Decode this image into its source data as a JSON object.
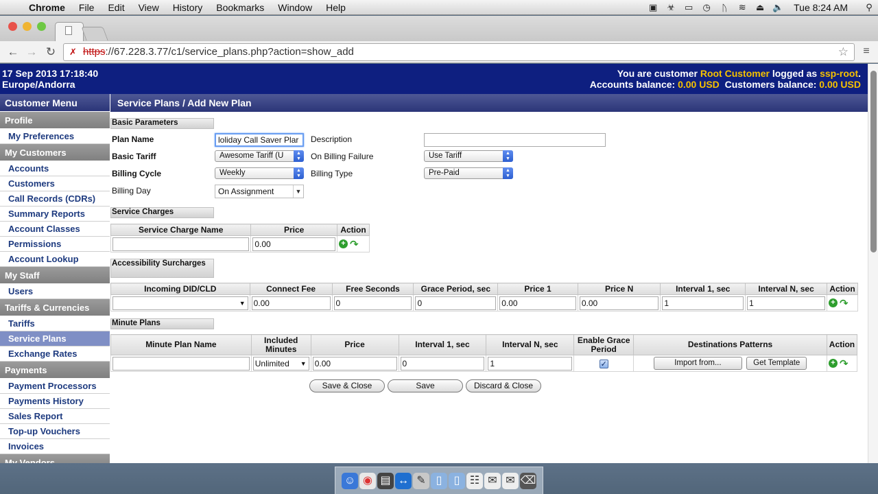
{
  "os_menubar": {
    "app_name": "Chrome",
    "menus": [
      "File",
      "Edit",
      "View",
      "History",
      "Bookmarks",
      "Window",
      "Help"
    ],
    "clock": "Tue 8:24 AM"
  },
  "browser": {
    "url_scheme": "https",
    "url_rest": "://67.228.3.77/c1/service_plans.php?action=show_add"
  },
  "header": {
    "datetime": "17 Sep 2013 17:18:40",
    "timezone": "Europe/Andorra",
    "you_are": "You are customer",
    "customer_name": "Root Customer",
    "logged_as": "logged as",
    "login": "ssp-root",
    "period": ".",
    "accounts_balance_label": "Accounts balance:",
    "accounts_balance": "0.00 USD",
    "customers_balance_label": "Customers balance:",
    "customers_balance": "0.00 USD"
  },
  "sidebar": {
    "title": "Customer Menu",
    "groups": [
      {
        "label": "Profile",
        "items": [
          "My Preferences"
        ]
      },
      {
        "label": "My Customers",
        "items": [
          "Accounts",
          "Customers",
          "Call Records (CDRs)",
          "Summary Reports",
          "Account Classes",
          "Permissions",
          "Account Lookup"
        ]
      },
      {
        "label": "My Staff",
        "items": [
          "Users"
        ]
      },
      {
        "label": "Tariffs & Currencies",
        "items": [
          "Tariffs",
          "Service Plans",
          "Exchange Rates"
        ]
      },
      {
        "label": "Payments",
        "items": [
          "Payment Processors",
          "Payments History",
          "Sales Report",
          "Top-up Vouchers",
          "Invoices"
        ]
      },
      {
        "label": "My Vendors",
        "items": []
      }
    ],
    "active_item": "Service Plans"
  },
  "page": {
    "title": "Service Plans / Add New Plan",
    "basic": {
      "section": "Basic Parameters",
      "plan_name_label": "Plan Name",
      "plan_name_value": "Holiday Call Saver Plan",
      "plan_name_visible": "loliday Call Saver Plar",
      "description_label": "Description",
      "description_value": "",
      "basic_tariff_label": "Basic Tariff",
      "basic_tariff_value": "Awesome Tariff (U",
      "on_billing_failure_label": "On Billing Failure",
      "on_billing_failure_value": "Use Tariff",
      "billing_cycle_label": "Billing Cycle",
      "billing_cycle_value": "Weekly",
      "billing_type_label": "Billing Type",
      "billing_type_value": "Pre-Paid",
      "billing_day_label": "Billing Day",
      "billing_day_value": "On Assignment"
    },
    "service_charges": {
      "section": "Service Charges",
      "headers": [
        "Service Charge Name",
        "Price",
        "Action"
      ],
      "row": {
        "name": "",
        "price": "0.00"
      }
    },
    "accessibility": {
      "section": "Accessibility Surcharges",
      "headers": [
        "Incoming DID/CLD",
        "Connect Fee",
        "Free Seconds",
        "Grace Period, sec",
        "Price 1",
        "Price N",
        "Interval 1, sec",
        "Interval N, sec",
        "Action"
      ],
      "row": {
        "did": "",
        "connect_fee": "0.00",
        "free_seconds": "0",
        "grace_period": "0",
        "price1": "0.00",
        "priceN": "0.00",
        "interval1": "1",
        "intervalN": "1"
      }
    },
    "minute_plans": {
      "section": "Minute Plans",
      "headers": [
        "Minute Plan Name",
        "Included Minutes",
        "Price",
        "Interval 1, sec",
        "Interval N, sec",
        "Enable Grace Period",
        "Destinations Patterns",
        "Action"
      ],
      "row": {
        "name": "",
        "included": "Unlimited",
        "price": "0.00",
        "interval1": "0",
        "intervalN": "1",
        "grace_enabled": true
      },
      "import_label": "Import from...",
      "template_label": "Get Template"
    },
    "buttons": {
      "save_close": "Save & Close",
      "save": "Save",
      "discard_close": "Discard & Close"
    }
  }
}
